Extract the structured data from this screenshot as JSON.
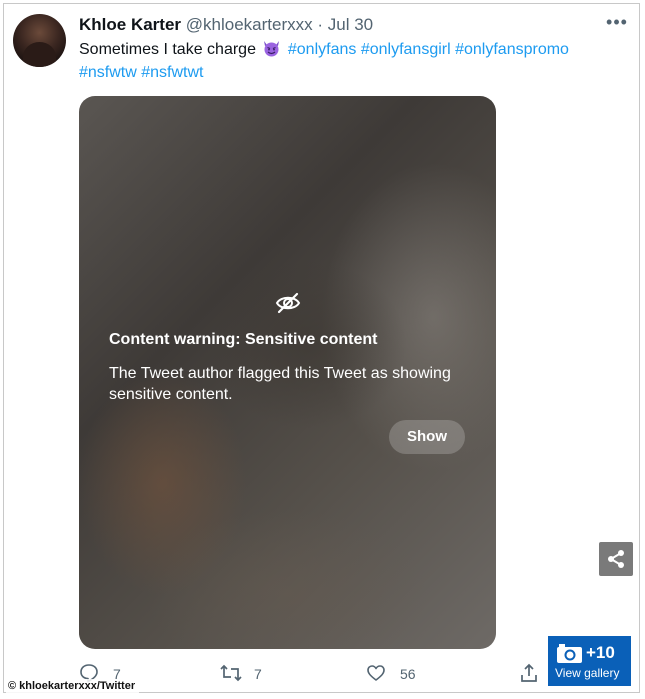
{
  "tweet": {
    "display_name": "Khloe Karter",
    "handle": "@khloekarterxxx",
    "separator": "·",
    "date": "Jul 30",
    "more_label": "•••",
    "text_prefix": "Sometimes I take charge",
    "emoji": "smiling-imp",
    "hashtags_line1": [
      "#onlyfans",
      "#onlyfansgirl",
      "#onlyfanspromo"
    ],
    "hashtags_line2": [
      "#nsfwtw",
      "#nsfwtwt"
    ]
  },
  "content_warning": {
    "icon": "eye-slash-icon",
    "title": "Content warning: Sensitive content",
    "body": "The Tweet author flagged this Tweet as showing sensitive content.",
    "show_label": "Show"
  },
  "actions": {
    "replies": "7",
    "retweets": "7",
    "likes": "56"
  },
  "overlay": {
    "gallery_count": "+10",
    "gallery_label": "View gallery",
    "credit": "© khloekarterxxx/Twitter",
    "colors": {
      "gallery_bg": "#0a60b8",
      "share_bg": "#7a7a7a",
      "hashtag": "#1d9bf0"
    }
  }
}
